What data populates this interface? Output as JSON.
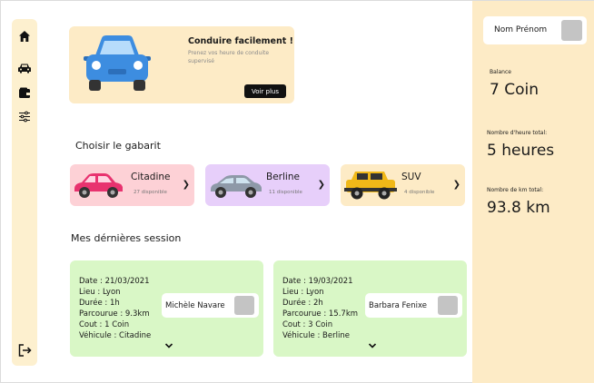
{
  "sidebar": {
    "icons": [
      "home-icon",
      "car-icon",
      "wallet-icon",
      "settings-sliders-icon",
      "logout-icon"
    ]
  },
  "hero": {
    "title": "Conduire facilement !",
    "subtitle": "Prenez vos heure de conduite supervisé",
    "button_label": "Voir plus",
    "car_color": "#3d8de0"
  },
  "gabarit": {
    "title": "Choisir le gabarit",
    "items": [
      {
        "name": "Citadine",
        "count": "27 disponible",
        "bg": "#fdd1d6"
      },
      {
        "name": "Berline",
        "count": "11 disponible",
        "bg": "#e7cffa"
      },
      {
        "name": "SUV",
        "count": "4 disponible",
        "bg": "#fdebc6"
      }
    ]
  },
  "sessions": {
    "title": "Mes dérnières session",
    "items": [
      {
        "date": "Date : 21/03/2021",
        "lieu": "Lieu : Lyon",
        "duree": "Durée : 1h",
        "parcourue": "Parcourue : 9.3km",
        "cout": "Cout : 1 Coin",
        "vehicule": "Véhicule : Citadine",
        "driver": "Michèle Navare"
      },
      {
        "date": "Date : 19/03/2021",
        "lieu": "Lieu : Lyon",
        "duree": "Durée : 2h",
        "parcourue": "Parcourue : 15.7km",
        "cout": "Cout : 3 Coin",
        "vehicule": "Véhicule : Berline",
        "driver": "Barbara Fenixe"
      }
    ]
  },
  "profile": {
    "name": "Nom Prénom",
    "balance_label": "Balance",
    "balance_value": "7 Coin",
    "hours_label": "Nombre d'heure total:",
    "hours_value": "5 heures",
    "km_label": "Nombre de km total:",
    "km_value": "93.8 km"
  },
  "colors": {
    "accent": "#fdebc6",
    "sidebar": "#fdf0cf",
    "session_bg": "#d9f7c6"
  }
}
